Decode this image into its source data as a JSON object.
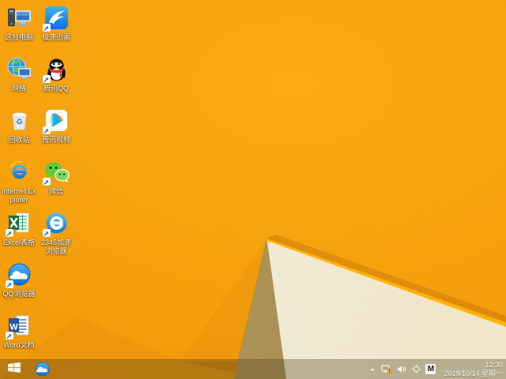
{
  "colors": {
    "wallpaper_orange": "#f5a00e",
    "ridge_orange": "#ffb400",
    "cream_triangle": "#f3ecd8",
    "tan_triangle": "#ab9157",
    "taskbar_tint": "rgba(78,68,34,0.34)"
  },
  "desktop": {
    "icons": [
      {
        "name": "this-pc",
        "label": "这台电脑",
        "col": 0,
        "row": 0,
        "shortcut": false
      },
      {
        "name": "xunlei",
        "label": "极速迅雷",
        "col": 1,
        "row": 0,
        "shortcut": true
      },
      {
        "name": "network",
        "label": "网络",
        "col": 0,
        "row": 1,
        "shortcut": false
      },
      {
        "name": "qq",
        "label": "腾讯QQ",
        "col": 1,
        "row": 1,
        "shortcut": true
      },
      {
        "name": "recycle-bin",
        "label": "回收站",
        "col": 0,
        "row": 2,
        "shortcut": false
      },
      {
        "name": "tencent-video",
        "label": "腾讯视频",
        "col": 1,
        "row": 2,
        "shortcut": true
      },
      {
        "name": "internet-explorer",
        "label": "Internet Explorer",
        "col": 0,
        "row": 3,
        "shortcut": false
      },
      {
        "name": "wechat",
        "label": "微信",
        "col": 1,
        "row": 3,
        "shortcut": true
      },
      {
        "name": "excel",
        "label": "Excel表格",
        "col": 0,
        "row": 4,
        "shortcut": true
      },
      {
        "name": "browser-2345",
        "label": "2345加速浏览器",
        "col": 1,
        "row": 4,
        "shortcut": true
      },
      {
        "name": "qq-browser",
        "label": "QQ浏览器",
        "col": 0,
        "row": 5,
        "shortcut": true
      },
      {
        "name": "word",
        "label": "Word文档",
        "col": 0,
        "row": 6,
        "shortcut": true
      }
    ]
  },
  "taskbar": {
    "start_button": {
      "name": "start"
    },
    "pinned": [
      {
        "name": "qq-browser"
      }
    ],
    "tray": {
      "icons": [
        {
          "name": "hidden-icons-arrow"
        },
        {
          "name": "network-warning"
        },
        {
          "name": "volume"
        },
        {
          "name": "safety-center"
        },
        {
          "name": "ime-m",
          "label": "M"
        }
      ],
      "clock": {
        "time": "12:30",
        "date": "2019/10/14 星期一"
      }
    }
  }
}
